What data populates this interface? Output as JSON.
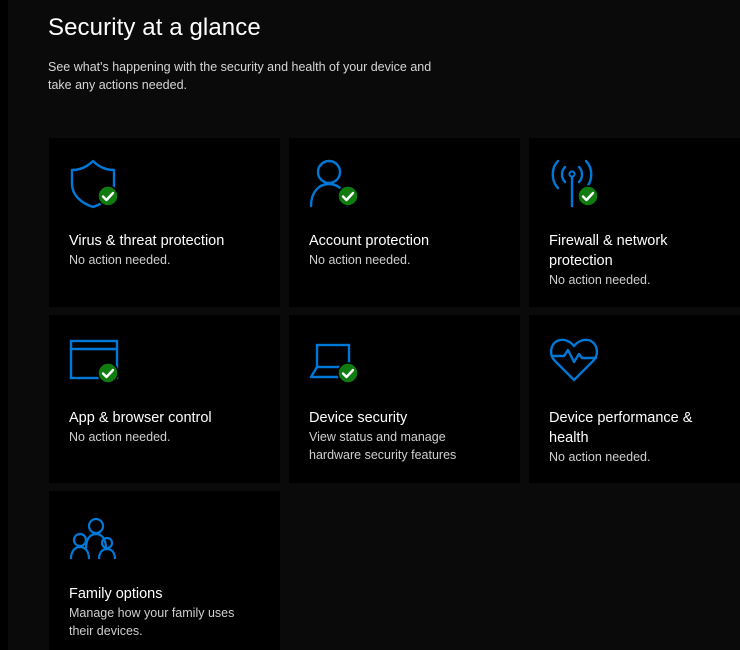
{
  "page": {
    "title": "Security at a glance",
    "subtitle": "See what's happening with the security and health of your device and take any actions needed."
  },
  "colors": {
    "accent_blue": "#0078d7",
    "ok_green": "#107c10",
    "tile_bg": "#000000",
    "page_bg": "#0a0a0a"
  },
  "tiles": [
    {
      "title": "Virus & threat protection",
      "status": "No action needed.",
      "icon": "shield-icon",
      "badge": "check"
    },
    {
      "title": "Account protection",
      "status": "No action needed.",
      "icon": "person-icon",
      "badge": "check"
    },
    {
      "title": "Firewall & network protection",
      "status": "No action needed.",
      "icon": "antenna-icon",
      "badge": "check"
    },
    {
      "title": "App & browser control",
      "status": "No action needed.",
      "icon": "browser-window-icon",
      "badge": "check"
    },
    {
      "title": "Device security",
      "status": "View status and manage hardware security features",
      "icon": "laptop-icon",
      "badge": "check"
    },
    {
      "title": "Device performance & health",
      "status": "No action needed.",
      "icon": "heart-pulse-icon",
      "badge": "none"
    },
    {
      "title": "Family options",
      "status": "Manage how your family uses their devices.",
      "icon": "family-icon",
      "badge": "none"
    }
  ]
}
